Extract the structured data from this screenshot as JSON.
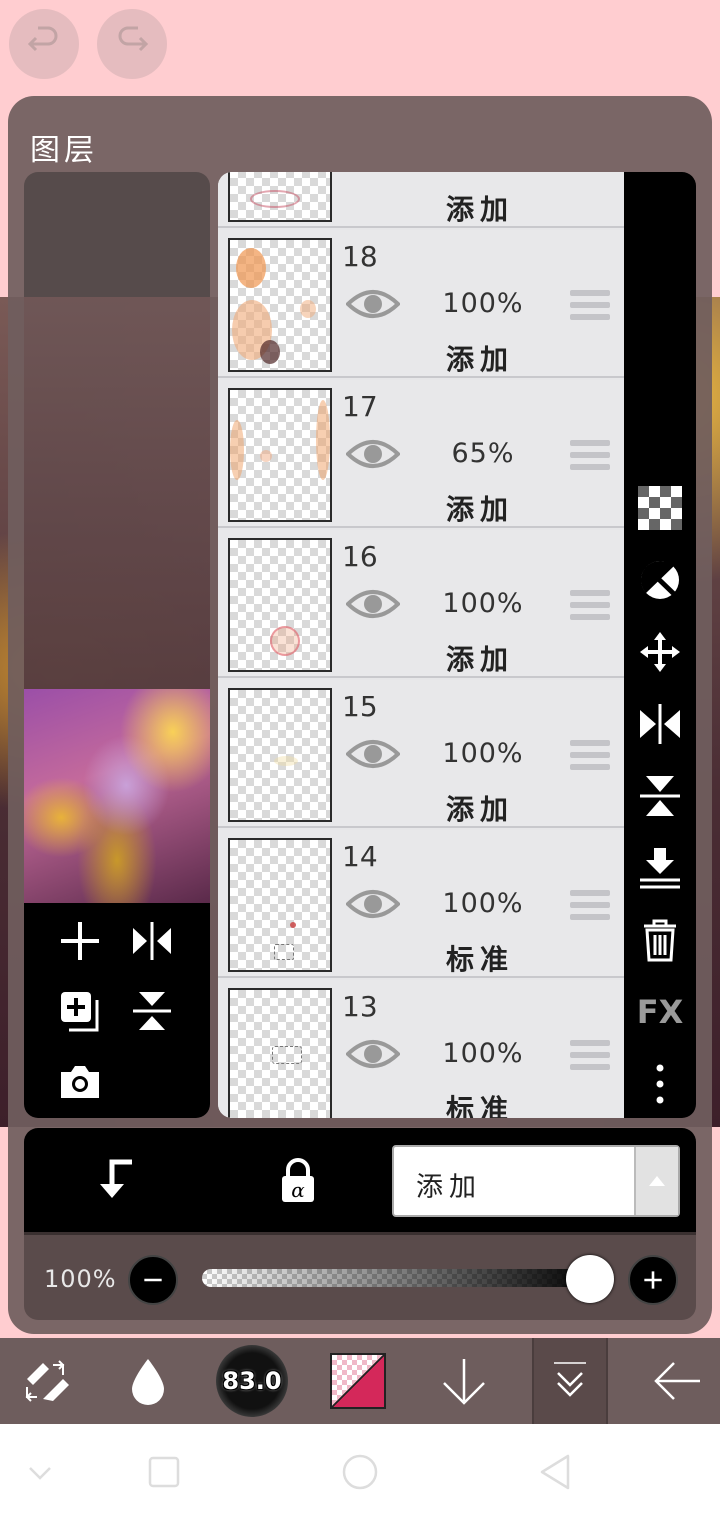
{
  "panel": {
    "title": "图层"
  },
  "layers": [
    {
      "number": "",
      "opacity": "",
      "blend": "添加",
      "partial": true
    },
    {
      "number": "18",
      "opacity": "100%",
      "blend": "添加"
    },
    {
      "number": "17",
      "opacity": "65%",
      "blend": "添加"
    },
    {
      "number": "16",
      "opacity": "100%",
      "blend": "添加"
    },
    {
      "number": "15",
      "opacity": "100%",
      "blend": "添加"
    },
    {
      "number": "14",
      "opacity": "100%",
      "blend": "标准"
    },
    {
      "number": "13",
      "opacity": "100%",
      "blend": "标准"
    }
  ],
  "right_tools": [
    "checkerboard-icon",
    "contrast-icon",
    "move-icon",
    "flip-horizontal-icon",
    "flip-vertical-icon",
    "merge-down-icon",
    "trash-icon",
    "fx-label",
    "more-icon"
  ],
  "fx_label": "FX",
  "left_tools": [
    "add-layer-icon",
    "flip-horizontal-icon",
    "duplicate-layer-icon",
    "flip-vertical-icon",
    "camera-icon"
  ],
  "controls": {
    "blend_mode": "添加",
    "opacity_label": "100%",
    "opacity_value": 1.0
  },
  "toolbar": {
    "brush_size": "83.0",
    "primary_color": "#d4285a",
    "secondary_color": "transparent"
  },
  "colors": {
    "accent_pink": "#ffcdd0",
    "panel": "#705e5e",
    "toolbar": "#6e5d5d"
  }
}
